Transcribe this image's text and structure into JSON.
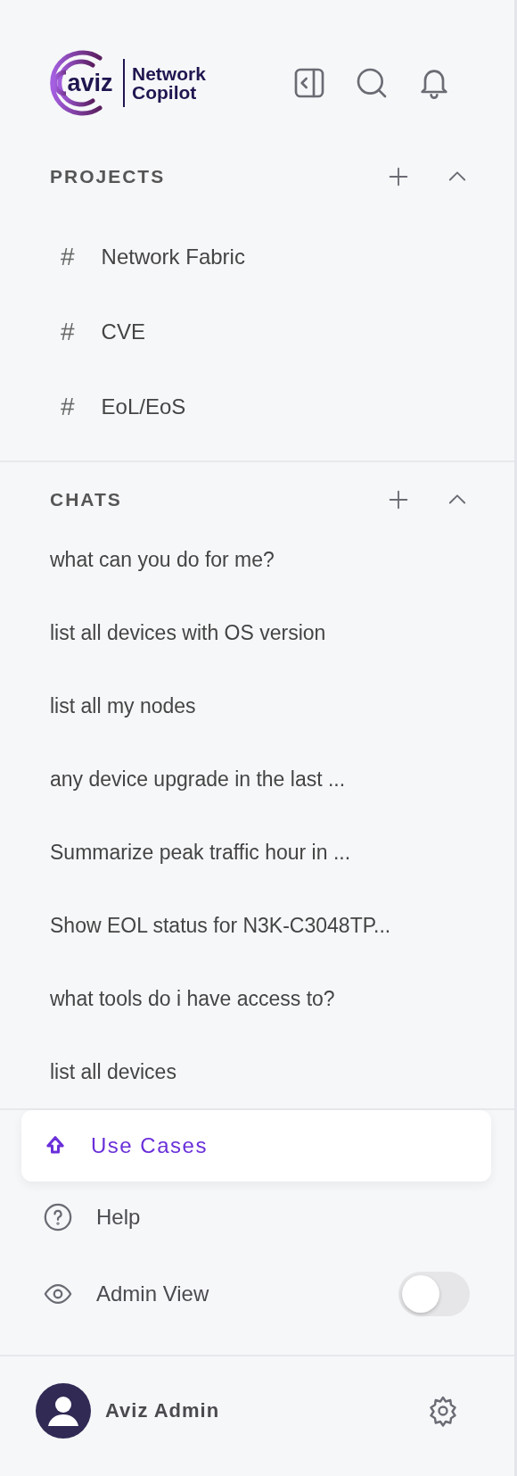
{
  "logo": {
    "mark": "aviz",
    "product_line1": "Network",
    "product_line2": "Copilot"
  },
  "projects": {
    "title": "PROJECTS",
    "expanded": true,
    "items": [
      {
        "icon": "#",
        "label": "Network Fabric"
      },
      {
        "icon": "#",
        "label": "CVE"
      },
      {
        "icon": "#",
        "label": "EoL/EoS"
      }
    ]
  },
  "chats": {
    "title": "CHATS",
    "expanded": true,
    "items": [
      {
        "label": "what can you do for me?"
      },
      {
        "label": "list all devices with OS version"
      },
      {
        "label": "list all my nodes"
      },
      {
        "label": "any device upgrade in the last ..."
      },
      {
        "label": "Summarize peak traffic hour in ..."
      },
      {
        "label": "Show EOL status for N3K-C3048TP..."
      },
      {
        "label": "what tools do i have access to?"
      },
      {
        "label": "list all devices"
      }
    ]
  },
  "menu": [
    {
      "kind": "link",
      "label": "Use Cases",
      "selected": true
    },
    {
      "kind": "link",
      "label": "Help",
      "selected": false
    },
    {
      "kind": "toggle",
      "label": "Admin View",
      "selected": false,
      "on": false
    }
  ],
  "user": {
    "name": "Aviz Admin"
  }
}
